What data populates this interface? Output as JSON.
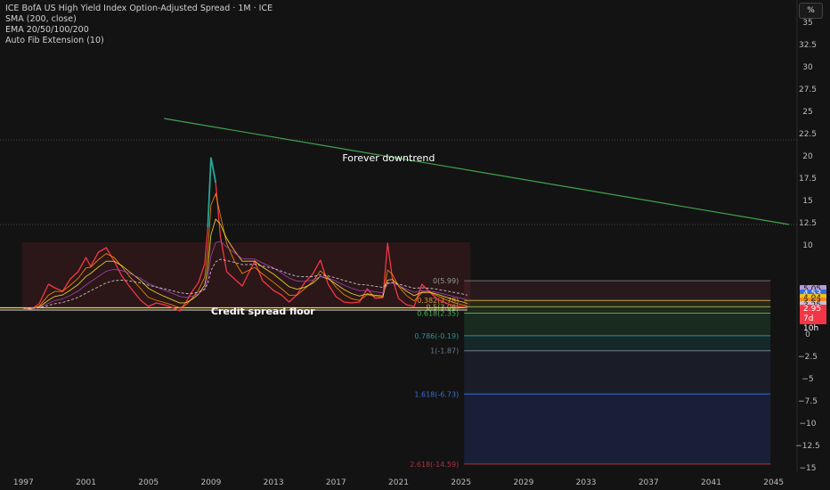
{
  "header": {
    "title": "ICE BofA US High Yield Index Option-Adjusted Spread · 1M · ICE",
    "indicators": [
      "SMA (200, close)",
      "EMA 20/50/100/200",
      "Auto Fib Extension (10)"
    ],
    "unit_button": "%"
  },
  "price_tags": [
    {
      "text": "5.05",
      "value": 5.05,
      "bg": "#b39ddb",
      "fg": "#1a1a1a"
    },
    {
      "text": "4.53",
      "value": 4.53,
      "bg": "#3d6bd6",
      "fg": "#ffffff"
    },
    {
      "text": "4.04",
      "value": 4.04,
      "bg": "#f0c020",
      "fg": "#1a1a1a"
    },
    {
      "text": "3.63",
      "value": 3.63,
      "bg": "#f08a24",
      "fg": "#1a1a1a"
    },
    {
      "text": "3.25",
      "value": 3.25,
      "bg": "#c8c0d8",
      "fg": "#1a1a1a"
    }
  ],
  "current_price": {
    "value": 2.95,
    "text": "2.95",
    "countdown": "7d 10h",
    "bg": "#f23645",
    "fg": "#ffffff"
  },
  "annotations": {
    "downtrend": "Forever downtrend",
    "floor": "Credit spread floor"
  },
  "chart_data": {
    "type": "line",
    "title": "ICE BofA US High Yield Index Option-Adjusted Spread · 1M · ICE",
    "xlabel": "",
    "ylabel": "",
    "y_unit": "%",
    "xlim": [
      1995.5,
      2046.5
    ],
    "ylim": [
      -15.5,
      37.5
    ],
    "x_ticks": [
      "1997",
      "2001",
      "2005",
      "2009",
      "2013",
      "2017",
      "2021",
      "2025",
      "2029",
      "2033",
      "2037",
      "2041",
      "2045"
    ],
    "y_ticks": [
      "35",
      "32.5",
      "30",
      "27.5",
      "25",
      "22.5",
      "20",
      "17.5",
      "15",
      "12.5",
      "10",
      "5",
      "0",
      "-2.5",
      "-5",
      "-7.5",
      "-10",
      "-12.5",
      "-15"
    ],
    "grid": false,
    "series": [
      {
        "color": "#f23645",
        "x": [
          1997,
          1997.5,
          1998,
          1998.6,
          1999,
          1999.5,
          2000,
          2000.5,
          2001,
          2001.3,
          2001.8,
          2002.3,
          2002.8,
          2003.3,
          2003.8,
          2004.5,
          2005,
          2005.5,
          2006,
          2006.5,
          2007,
          2007.4,
          2007.8,
          2008.2,
          2008.6,
          2008.8,
          2009,
          2009.3,
          2009.6,
          2010,
          2010.5,
          2011,
          2011.8,
          2012.3,
          2013,
          2013.5,
          2014,
          2014.5,
          2015,
          2015.5,
          2016,
          2016.5,
          2017,
          2017.5,
          2018,
          2018.5,
          2019,
          2019.5,
          2020,
          2020.3,
          2020.6,
          2021,
          2021.5,
          2022,
          2022.5,
          2023,
          2023.5,
          2024,
          2024.5,
          2025,
          2025.4
        ],
        "y": [
          2.9,
          2.8,
          3.4,
          5.6,
          5.2,
          4.8,
          6.2,
          7.0,
          8.6,
          7.6,
          9.2,
          9.7,
          8.2,
          6.5,
          5.3,
          3.8,
          3.1,
          3.5,
          3.3,
          3.0,
          2.6,
          3.6,
          4.8,
          5.8,
          7.9,
          12.0,
          19.8,
          17.0,
          11.0,
          7.0,
          6.2,
          5.4,
          8.2,
          6.0,
          4.9,
          4.4,
          3.6,
          4.4,
          5.8,
          6.7,
          8.3,
          5.6,
          4.2,
          3.6,
          3.5,
          3.6,
          5.1,
          4.0,
          4.1,
          10.2,
          6.3,
          4.0,
          3.3,
          3.1,
          5.6,
          4.7,
          3.9,
          3.5,
          3.2,
          3.1,
          2.95
        ]
      }
    ],
    "trendline": {
      "label": "Forever downtrend",
      "x": [
        2006,
        2046
      ],
      "y": [
        24.2,
        12.3
      ]
    },
    "floor_line": {
      "label": "Credit spread floor",
      "y": 2.95
    },
    "fib_levels": [
      {
        "ratio": "0",
        "value": 5.99,
        "label": "0(5.99)"
      },
      {
        "ratio": "0.382",
        "value": 3.78,
        "label": "0.382(3.78)"
      },
      {
        "ratio": "0.5",
        "value": 3.06,
        "label": "0.5(3.06)"
      },
      {
        "ratio": "0.618",
        "value": 2.35,
        "label": "0.618(2.35)"
      },
      {
        "ratio": "0.786",
        "value": -0.19,
        "label": "0.786(-0.19)"
      },
      {
        "ratio": "1",
        "value": -1.87,
        "label": "1(-1.87)"
      },
      {
        "ratio": "1.618",
        "value": -6.73,
        "label": "1.618(-6.73)"
      },
      {
        "ratio": "2.618",
        "value": -14.59,
        "label": "2.618(-14.59)"
      }
    ]
  }
}
